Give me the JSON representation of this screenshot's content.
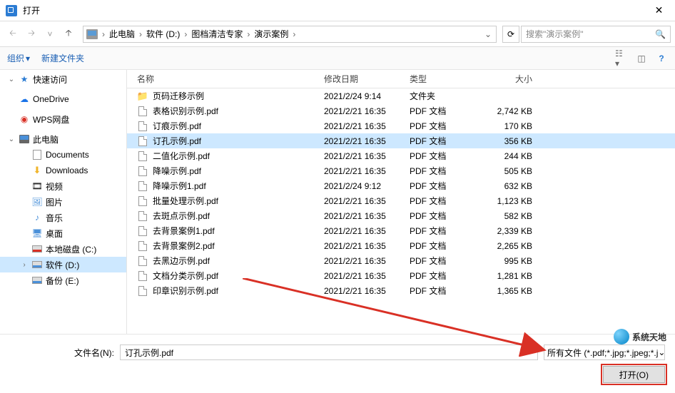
{
  "window": {
    "title": "打开"
  },
  "breadcrumb": {
    "items": [
      "此电脑",
      "软件 (D:)",
      "图档清洁专家",
      "演示案例"
    ]
  },
  "search": {
    "placeholder": "搜索\"演示案例\""
  },
  "toolbar": {
    "organize": "组织",
    "newfolder": "新建文件夹"
  },
  "sidebar": {
    "quick": "快速访问",
    "onedrive": "OneDrive",
    "wps": "WPS网盘",
    "thispc": "此电脑",
    "documents": "Documents",
    "downloads": "Downloads",
    "videos": "视频",
    "pictures": "图片",
    "music": "音乐",
    "desktop": "桌面",
    "drive_c": "本地磁盘 (C:)",
    "drive_d": "软件 (D:)",
    "drive_e": "备份 (E:)"
  },
  "columns": {
    "name": "名称",
    "date": "修改日期",
    "type": "类型",
    "size": "大小"
  },
  "files": [
    {
      "name": "页码迁移示例",
      "date": "2021/2/24 9:14",
      "type": "文件夹",
      "size": "",
      "kind": "folder"
    },
    {
      "name": "表格识别示例.pdf",
      "date": "2021/2/21 16:35",
      "type": "PDF 文档",
      "size": "2,742 KB",
      "kind": "pdf"
    },
    {
      "name": "订痕示例.pdf",
      "date": "2021/2/21 16:35",
      "type": "PDF 文档",
      "size": "170 KB",
      "kind": "pdf"
    },
    {
      "name": "订孔示例.pdf",
      "date": "2021/2/21 16:35",
      "type": "PDF 文档",
      "size": "356 KB",
      "kind": "pdf",
      "selected": true
    },
    {
      "name": "二值化示例.pdf",
      "date": "2021/2/21 16:35",
      "type": "PDF 文档",
      "size": "244 KB",
      "kind": "pdf"
    },
    {
      "name": "降噪示例.pdf",
      "date": "2021/2/21 16:35",
      "type": "PDF 文档",
      "size": "505 KB",
      "kind": "pdf"
    },
    {
      "name": "降噪示例1.pdf",
      "date": "2021/2/24 9:12",
      "type": "PDF 文档",
      "size": "632 KB",
      "kind": "pdf"
    },
    {
      "name": "批量处理示例.pdf",
      "date": "2021/2/21 16:35",
      "type": "PDF 文档",
      "size": "1,123 KB",
      "kind": "pdf"
    },
    {
      "name": "去斑点示例.pdf",
      "date": "2021/2/21 16:35",
      "type": "PDF 文档",
      "size": "582 KB",
      "kind": "pdf"
    },
    {
      "name": "去背景案例1.pdf",
      "date": "2021/2/21 16:35",
      "type": "PDF 文档",
      "size": "2,339 KB",
      "kind": "pdf"
    },
    {
      "name": "去背景案例2.pdf",
      "date": "2021/2/21 16:35",
      "type": "PDF 文档",
      "size": "2,265 KB",
      "kind": "pdf"
    },
    {
      "name": "去黑边示例.pdf",
      "date": "2021/2/21 16:35",
      "type": "PDF 文档",
      "size": "995 KB",
      "kind": "pdf"
    },
    {
      "name": "文档分类示例.pdf",
      "date": "2021/2/21 16:35",
      "type": "PDF 文档",
      "size": "1,281 KB",
      "kind": "pdf"
    },
    {
      "name": "印章识别示例.pdf",
      "date": "2021/2/21 16:35",
      "type": "PDF 文档",
      "size": "1,365 KB",
      "kind": "pdf"
    }
  ],
  "filename": {
    "label": "文件名(N):",
    "value": "订孔示例.pdf"
  },
  "filter": "所有文件 (*.pdf;*.jpg;*.jpeg;*.j",
  "buttons": {
    "open": "打开(O)"
  },
  "watermark": "系统天地"
}
